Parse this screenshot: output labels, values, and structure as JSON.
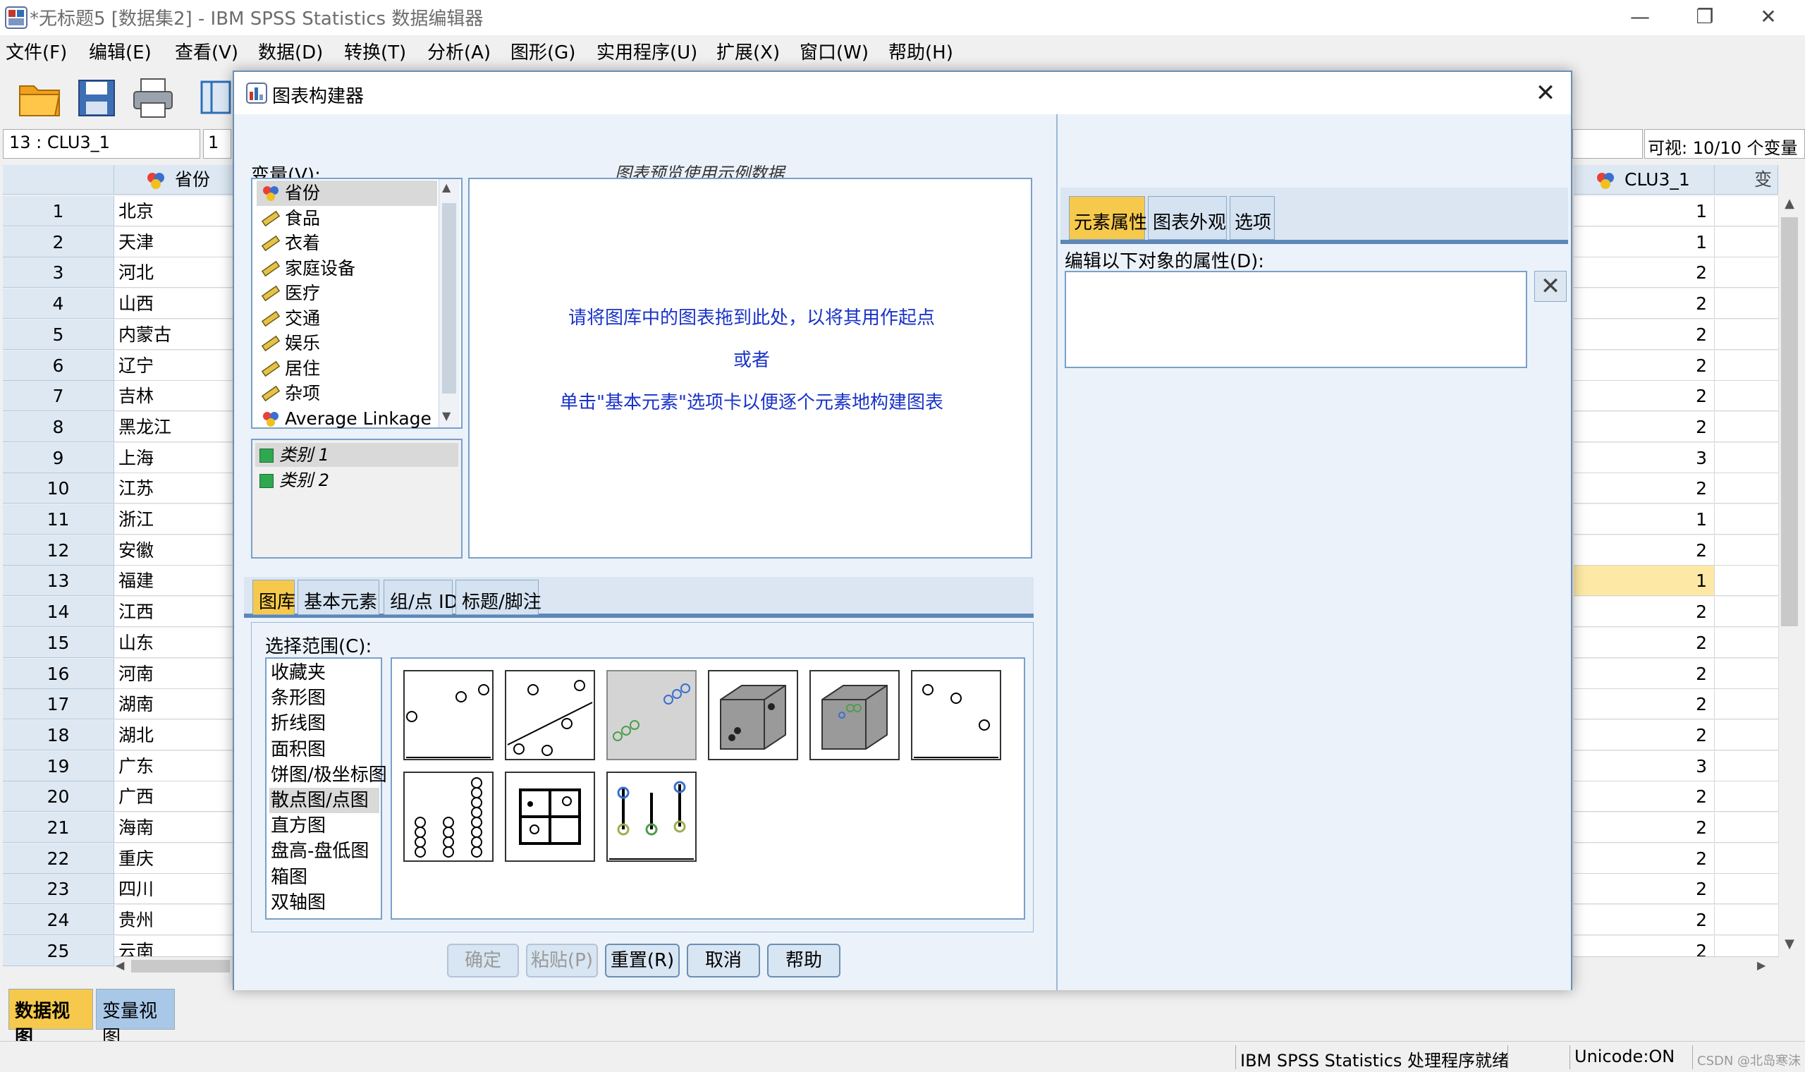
{
  "window": {
    "title": "*无标题5 [数据集2] - IBM SPSS Statistics 数据编辑器",
    "min": "—",
    "max": "❐",
    "close": "✕"
  },
  "menu": [
    "文件(F)",
    "编辑(E)",
    "查看(V)",
    "数据(D)",
    "转换(T)",
    "分析(A)",
    "图形(G)",
    "实用程序(U)",
    "扩展(X)",
    "窗口(W)",
    "帮助(H)"
  ],
  "toolbar": {
    "icons": [
      "open-folder-icon",
      "save-icon",
      "print-icon",
      "dialog-recall-icon"
    ]
  },
  "editor": {
    "cell_ref": "13 : CLU3_1",
    "cell_value": "1",
    "visible_info": "可视: 10/10 个变量",
    "col_province": "省份",
    "col_clu": "CLU3_1",
    "col_next": "变",
    "selected_row": 13,
    "rows": [
      {
        "n": "1",
        "name": "北京",
        "clu": "1"
      },
      {
        "n": "2",
        "name": "天津",
        "clu": "1"
      },
      {
        "n": "3",
        "name": "河北",
        "clu": "2"
      },
      {
        "n": "4",
        "name": "山西",
        "clu": "2"
      },
      {
        "n": "5",
        "name": "内蒙古",
        "clu": "2"
      },
      {
        "n": "6",
        "name": "辽宁",
        "clu": "2"
      },
      {
        "n": "7",
        "name": "吉林",
        "clu": "2"
      },
      {
        "n": "8",
        "name": "黑龙江",
        "clu": "2"
      },
      {
        "n": "9",
        "name": "上海",
        "clu": "3"
      },
      {
        "n": "10",
        "name": "江苏",
        "clu": "2"
      },
      {
        "n": "11",
        "name": "浙江",
        "clu": "1"
      },
      {
        "n": "12",
        "name": "安徽",
        "clu": "2"
      },
      {
        "n": "13",
        "name": "福建",
        "clu": "1"
      },
      {
        "n": "14",
        "name": "江西",
        "clu": "2"
      },
      {
        "n": "15",
        "name": "山东",
        "clu": "2"
      },
      {
        "n": "16",
        "name": "河南",
        "clu": "2"
      },
      {
        "n": "17",
        "name": "湖南",
        "clu": "2"
      },
      {
        "n": "18",
        "name": "湖北",
        "clu": "2"
      },
      {
        "n": "19",
        "name": "广东",
        "clu": "3"
      },
      {
        "n": "20",
        "name": "广西",
        "clu": "2"
      },
      {
        "n": "21",
        "name": "海南",
        "clu": "2"
      },
      {
        "n": "22",
        "name": "重庆",
        "clu": "2"
      },
      {
        "n": "23",
        "name": "四川",
        "clu": "2"
      },
      {
        "n": "24",
        "name": "贵州",
        "clu": "2"
      },
      {
        "n": "25",
        "name": "云南",
        "clu": "2"
      }
    ],
    "view_tabs": [
      "数据视图",
      "变量视图"
    ]
  },
  "status": {
    "processor": "IBM SPSS Statistics 处理程序就绪",
    "unicode": "Unicode:ON",
    "watermark": "CSDN @北岛寒沫"
  },
  "dialog": {
    "title": "图表构建器",
    "variables_label": "变量(V):",
    "preview_note": "图表预览使用示例数据",
    "variables": [
      {
        "label": "省份",
        "type": "nominal"
      },
      {
        "label": "食品",
        "type": "scale"
      },
      {
        "label": "衣着",
        "type": "scale"
      },
      {
        "label": "家庭设备",
        "type": "scale"
      },
      {
        "label": "医疗",
        "type": "scale"
      },
      {
        "label": "交通",
        "type": "scale"
      },
      {
        "label": "娱乐",
        "type": "scale"
      },
      {
        "label": "居住",
        "type": "scale"
      },
      {
        "label": "杂项",
        "type": "scale"
      },
      {
        "label": "Average Linkage ...",
        "type": "nominal"
      }
    ],
    "categories": [
      "类别 1",
      "类别 2"
    ],
    "canvas_lines": [
      "请将图库中的图表拖到此处，以将其用作起点",
      "或者",
      "单击\"基本元素\"选项卡以便逐个元素地构建图表"
    ],
    "left_tabs": [
      "图库",
      "基本元素",
      "组/点 ID",
      "标题/脚注"
    ],
    "range_label": "选择范围(C):",
    "ranges": [
      "收藏夹",
      "条形图",
      "折线图",
      "面积图",
      "饼图/极坐标图",
      "散点图/点图",
      "直方图",
      "盘高-盘低图",
      "箱图",
      "双轴图"
    ],
    "selected_range": "散点图/点图",
    "buttons": {
      "ok": "确定",
      "paste": "粘贴(P)",
      "reset": "重置(R)",
      "cancel": "取消",
      "help": "帮助"
    },
    "right_tabs": [
      "元素属性",
      "图表外观",
      "选项"
    ],
    "edit_label": "编辑以下对象的属性(D):"
  }
}
